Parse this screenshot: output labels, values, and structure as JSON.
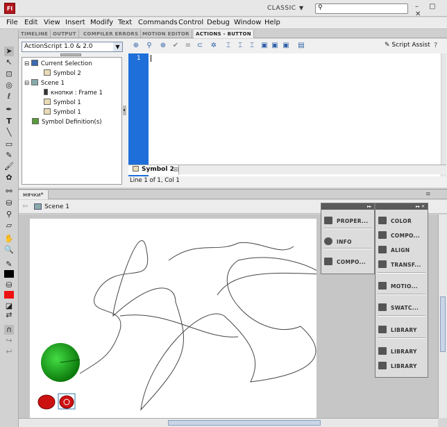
{
  "app": {
    "logo": "Fl",
    "workspace": "CLASSIC",
    "search_placeholder": "",
    "window_buttons": "–  ▢  ✕"
  },
  "menu": [
    "File",
    "Edit",
    "View",
    "Insert",
    "Modify",
    "Text",
    "Commands",
    "Control",
    "Debug",
    "Window",
    "Help"
  ],
  "panel_tabs": [
    "TIMELINE",
    "OUTPUT",
    "COMPILER ERRORS",
    "MOTION EDITOR",
    "ACTIONS - BUTTON"
  ],
  "actions": {
    "language": "ActionScript 1.0 & 2.0",
    "tree": [
      "Current Selection",
      "Symbol 2",
      "Scene 1",
      "кнопки : Frame 1",
      "Symbol 1",
      "Symbol 1",
      "Symbol Definition(s)"
    ],
    "line_number": "1",
    "script_assist": "Script Assist",
    "script_tab": "Symbol 2",
    "status": "Line 1 of 1, Col 1"
  },
  "document": {
    "tab": "мячки*",
    "scene": "Scene 1"
  },
  "dock_left": [
    "PROPER...",
    "INFO",
    "COMPO..."
  ],
  "dock_right": [
    "COLOR",
    "COMPO...",
    "ALIGN",
    "TRANSF...",
    "MOTIO...",
    "SWATC...",
    "LIBRARY",
    "LIBRARY",
    "LIBRARY"
  ],
  "colors": {
    "accent": "#1e6fd9",
    "ball": "#1aa51a",
    "red_button": "#cc1111",
    "stroke_color": "#000000",
    "fill_color": "#ee1111"
  }
}
